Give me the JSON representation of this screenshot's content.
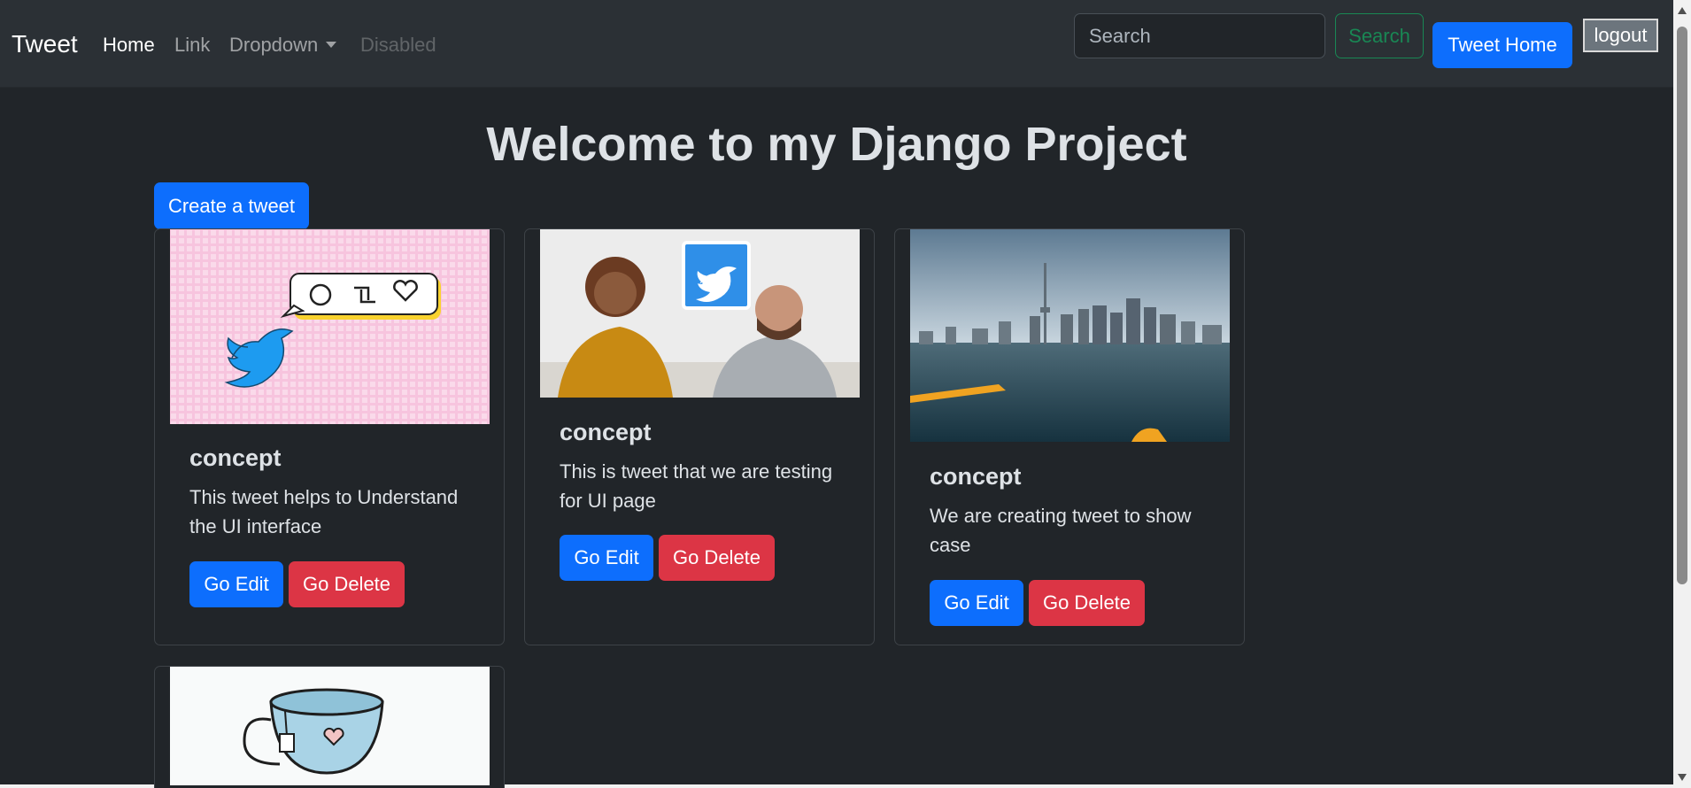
{
  "navbar": {
    "brand": "Tweet",
    "links": [
      {
        "label": "Home",
        "state": "active"
      },
      {
        "label": "Link",
        "state": "normal"
      },
      {
        "label": "Dropdown",
        "state": "dropdown"
      },
      {
        "label": "Disabled",
        "state": "disabled"
      }
    ],
    "search_placeholder": "Search",
    "search_button": "Search",
    "tweet_home_button": "Tweet Home",
    "logout_button": "logout"
  },
  "main": {
    "title": "Welcome to my Django Project",
    "create_button": "Create a tweet",
    "cards": [
      {
        "title": "concept",
        "text": "This tweet helps to Understand the UI interface",
        "edit": "Go Edit",
        "delete": "Go Delete",
        "image": "twitter-bird-speech-bubble"
      },
      {
        "title": "concept",
        "text": "This is tweet that we are testing for UI page",
        "edit": "Go Edit",
        "delete": "Go Delete",
        "image": "people-holding-twitter-logo"
      },
      {
        "title": "concept",
        "text": "We are creating tweet to show case",
        "edit": "Go Edit",
        "delete": "Go Delete",
        "image": "city-skyline-over-water"
      },
      {
        "title": "",
        "text": "",
        "edit": "",
        "delete": "",
        "image": "teacup-with-heart"
      }
    ]
  },
  "colors": {
    "background": "#212529",
    "navbar": "#2b3035",
    "primary": "#0d6efd",
    "danger": "#dc3545",
    "success": "#198754",
    "secondary": "#6c757d"
  }
}
